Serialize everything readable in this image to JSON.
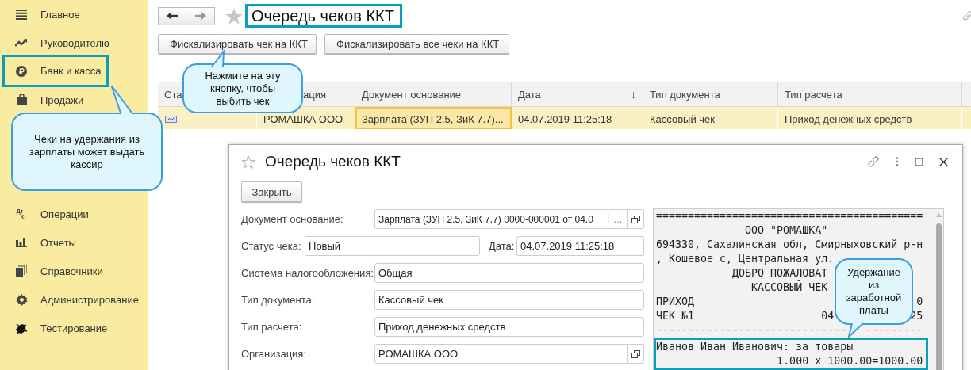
{
  "sidebar": {
    "items_top": [
      {
        "kind": "menu",
        "label": "Главное",
        "highlighted": false
      },
      {
        "kind": "trend",
        "label": "Руководителю",
        "highlighted": false
      },
      {
        "kind": "ruble",
        "label": "Банк и касса",
        "highlighted": true
      },
      {
        "kind": "bag",
        "label": "Продажи",
        "highlighted": false
      }
    ],
    "items_bottom": [
      {
        "kind": "dtkt",
        "label": "Операции",
        "icon_text": [
          "Дт",
          "Кт"
        ],
        "highlighted": false
      },
      {
        "kind": "chart",
        "label": "Отчеты",
        "highlighted": false
      },
      {
        "kind": "books",
        "label": "Справочники",
        "highlighted": false
      },
      {
        "kind": "gear",
        "label": "Администрирование",
        "highlighted": false
      },
      {
        "kind": "bug",
        "label": "Тестирование",
        "highlighted": false
      }
    ]
  },
  "page": {
    "title": "Очередь чеков ККТ",
    "title_highlighted": true,
    "buttons": [
      "Фискализировать чек на ККТ",
      "Фискализировать все чеки на ККТ"
    ]
  },
  "table": {
    "columns": [
      {
        "label": "Ста"
      },
      {
        "label": "ация"
      },
      {
        "label": "Документ основание"
      },
      {
        "label": "Дата",
        "sort_mark": "↓"
      },
      {
        "label": "Тип документа"
      },
      {
        "label": "Тип расчета"
      }
    ],
    "rows": [
      {
        "selected": true,
        "cells": [
          "",
          "РОМАШКА ООО",
          "Зарплата (ЗУП 2.5, ЗиК 7.7)...",
          "04.07.2019 11:25:18",
          "Кассовый чек",
          "Приход денежных средств"
        ]
      }
    ]
  },
  "dialog": {
    "title": "Очередь чеков ККТ",
    "close_button": "Закрыть",
    "doc_base": {
      "label": "Документ основание:",
      "value": "Зарплата (ЗУП 2.5, ЗиК 7.7) 0000-000001 от 04.0",
      "choice_button": "..."
    },
    "status": {
      "label": "Статус чека:",
      "value": "Новый"
    },
    "date": {
      "label": "Дата:",
      "value": "04.07.2019 11:25:18"
    },
    "fields": [
      {
        "label": "Система налогообложения:",
        "value": "Общая",
        "open_button": false
      },
      {
        "label": "Тип документа:",
        "value": "Кассовый чек",
        "open_button": false
      },
      {
        "label": "Тип расчета:",
        "value": "Приход денежных средств",
        "open_button": false
      },
      {
        "label": "Организация:",
        "value": "РОМАШКА ООО",
        "open_button": true
      }
    ],
    "receipt": {
      "blocks": [
        {
          "highlighted": false,
          "lines": [
            [
              "=========================================="
            ],
            [
              "              ООО \"РОМАШКА\""
            ],
            [
              "694330, Сахалинская обл, Смирныховский р-н"
            ],
            [
              ", Кошевое с, Центральная ул."
            ],
            [
              "            ДОБРО ПОЖАЛОВАТ"
            ],
            [
              "               КАССОВЫЙ ЧЕК"
            ],
            [
              "ПРИХОД",
              "                                   0"
            ],
            [
              "ЧЕК №1",
              "                    04",
              "            25"
            ],
            [
              "------------------------------",
              "   ---------"
            ]
          ]
        },
        {
          "highlighted": true,
          "lines": [
            [
              "Иванов Иван Иванович: за товары"
            ],
            [
              "                   1.000 x 1000.00=1000.00"
            ]
          ]
        }
      ]
    }
  },
  "callouts": [
    {
      "text": "Нажмите на эту кнопку, чтобы выбить чек"
    },
    {
      "text": "Чеки на удержания из зарплаты может выдать кассир"
    },
    {
      "text": "Удержание из заработной платы"
    }
  ]
}
